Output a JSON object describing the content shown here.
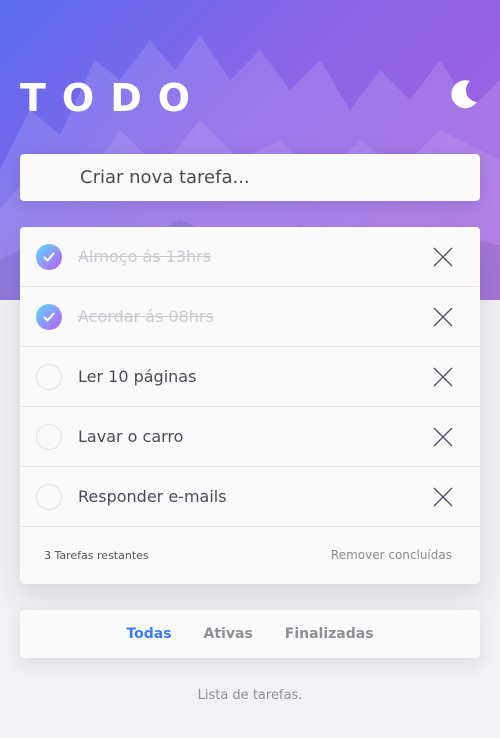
{
  "header": {
    "title": "TODO",
    "theme_icon": "moon-icon"
  },
  "new_task": {
    "placeholder": "Criar nova tarefa..."
  },
  "tasks": [
    {
      "text": "Almoço ás 13hrs",
      "completed": true
    },
    {
      "text": "Acordar ás 08hrs",
      "completed": true
    },
    {
      "text": "Ler 10 páginas",
      "completed": false
    },
    {
      "text": "Lavar o carro",
      "completed": false
    },
    {
      "text": "Responder e-mails",
      "completed": false
    }
  ],
  "footer": {
    "remaining": "3 Tarefas restantes",
    "clear_label": "Remover concluídas"
  },
  "filters": {
    "all": "Todas",
    "active": "Ativas",
    "completed": "Finalizadas",
    "selected": "all"
  },
  "hint": "Lista de tarefas.",
  "colors": {
    "accent": "#3a7bfd",
    "gradient_start": "#57ddff",
    "gradient_end": "#c058f3"
  }
}
